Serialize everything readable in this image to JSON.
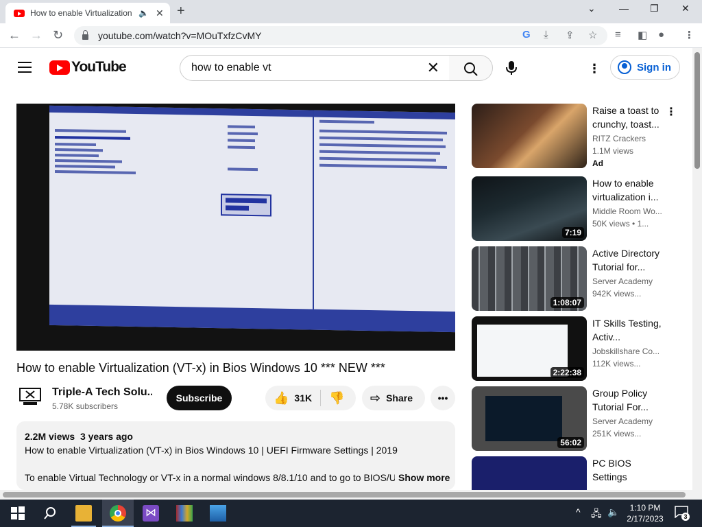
{
  "browser": {
    "tab_title": "How to enable Virtualization (VT-x) in Bios",
    "new_tab": "+",
    "url": "youtube.com/watch?v=MOuTxfzCvMY",
    "window_controls": {
      "minimize": "—",
      "restore": "❐",
      "close": "✕",
      "tab_list": "⌄"
    }
  },
  "youtube": {
    "logo_text": "YouTube",
    "search": {
      "query": "how to enable vt",
      "placeholder": "Search"
    },
    "sign_in": "Sign in"
  },
  "video": {
    "title": "How to enable Virtualization (VT-x) in Bios Windows 10 *** NEW ***",
    "channel": "Triple-A Tech Solu...",
    "subscribers": "5.78K subscribers",
    "subscribe_label": "Subscribe",
    "likes": "31K",
    "share_label": "Share",
    "views": "2.2M views",
    "age": "3 years ago",
    "desc_line1": "How to enable Virtualization (VT-x)  in Bios Windows 10 | UEFI Firmware Settings | 2019",
    "desc_line2": "To enable Virtual Technology or VT-x in a normal windows 8/8.1/10 and to go to BIOS/U",
    "show_more": "Show more"
  },
  "recommendations": [
    {
      "title": "Raise a toast to crunchy, toast...",
      "channel": "RITZ Crackers",
      "views": "1.1M views",
      "badge": "Ad",
      "duration": ""
    },
    {
      "title": "How to enable virtualization i...",
      "channel": "Middle Room Wo...",
      "views": "50K views • 1...",
      "badge": "",
      "duration": "7:19"
    },
    {
      "title": "Active Directory Tutorial for...",
      "channel": "Server Academy",
      "views": "942K views...",
      "badge": "",
      "duration": "1:08:07"
    },
    {
      "title": "IT Skills Testing, Activ...",
      "channel": "Jobskillshare Co...",
      "views": "112K views...",
      "badge": "",
      "duration": "2:22:38"
    },
    {
      "title": "Group Policy Tutorial For...",
      "channel": "Server Academy",
      "views": "251K views...",
      "badge": "",
      "duration": "56:02"
    },
    {
      "title": "PC BIOS Settings",
      "channel": "",
      "views": "",
      "badge": "",
      "duration": ""
    }
  ],
  "taskbar": {
    "time": "1:10 PM",
    "date": "2/17/2023",
    "notification_count": "3"
  }
}
